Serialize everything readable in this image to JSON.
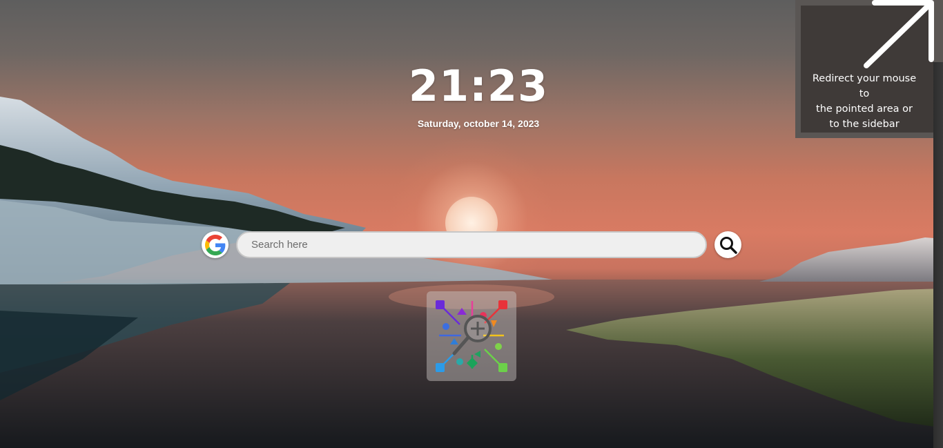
{
  "clock": {
    "time": "21:23",
    "date": "Saturday, october 14, 2023"
  },
  "search": {
    "placeholder": "Search here",
    "value": "",
    "engine_icon": "google-icon",
    "submit_icon": "search-icon"
  },
  "shortcut": {
    "icon": "mindmap-magnifier-app-icon"
  },
  "hint": {
    "line1": "Redirect your mouse",
    "line2": "to",
    "line3": "the pointed area or",
    "line4": "to the sidebar",
    "icon": "arrow-up-right-icon"
  },
  "colors": {
    "sky_top": "#5e5e5e",
    "sunset": "#d97b63",
    "water_dark": "#1c1f24",
    "search_bg": "#efefef"
  }
}
